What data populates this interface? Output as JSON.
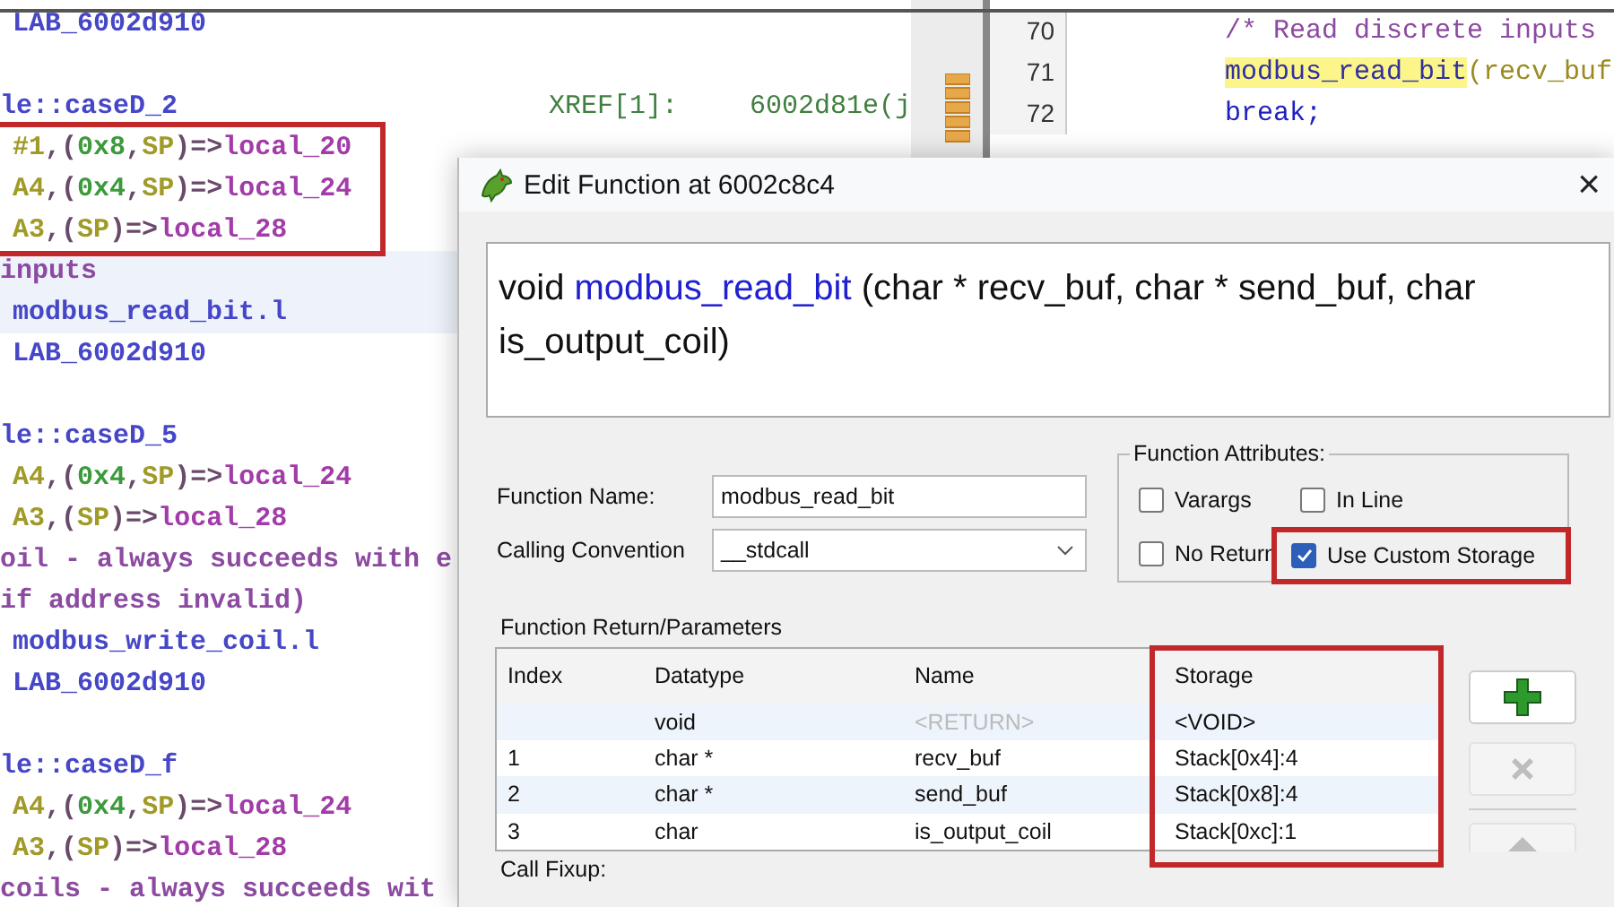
{
  "listing": {
    "lines": [
      {
        "kind": "code",
        "selected": false,
        "segments": [
          {
            "text": "LAB_6002d910",
            "kind": "label"
          }
        ]
      },
      {
        "kind": "blank"
      },
      {
        "kind": "header",
        "selected": false,
        "segments": [
          {
            "text": "le::caseD_2",
            "kind": "label"
          }
        ],
        "xref": {
          "label": "XREF[1]:",
          "address": "6002d81e(j"
        }
      },
      {
        "kind": "boxed_group",
        "lines": [
          {
            "kind": "code",
            "selected": false,
            "segments": [
              {
                "text": "#1",
                "kind": "reg"
              },
              {
                "text": ",(",
                "kind": "op"
              },
              {
                "text": "0x8",
                "kind": "num"
              },
              {
                "text": ",",
                "kind": "op"
              },
              {
                "text": "SP",
                "kind": "reg"
              },
              {
                "text": ")=>",
                "kind": "op"
              },
              {
                "text": "local_20",
                "kind": "local"
              }
            ]
          },
          {
            "kind": "code",
            "selected": false,
            "segments": [
              {
                "text": "A4",
                "kind": "reg"
              },
              {
                "text": ",(",
                "kind": "op"
              },
              {
                "text": "0x4",
                "kind": "num"
              },
              {
                "text": ",",
                "kind": "op"
              },
              {
                "text": "SP",
                "kind": "reg"
              },
              {
                "text": ")=>",
                "kind": "op"
              },
              {
                "text": "local_24",
                "kind": "local"
              }
            ]
          },
          {
            "kind": "code",
            "selected": false,
            "segments": [
              {
                "text": "A3",
                "kind": "reg"
              },
              {
                "text": ",(",
                "kind": "op"
              },
              {
                "text": "SP",
                "kind": "reg"
              },
              {
                "text": ")=>",
                "kind": "op"
              },
              {
                "text": "local_28",
                "kind": "local"
              }
            ]
          }
        ]
      },
      {
        "kind": "comment",
        "selected": true,
        "segments": [
          {
            "text": "inputs",
            "kind": "comment"
          }
        ]
      },
      {
        "kind": "code",
        "selected": true,
        "segments": [
          {
            "text": "modbus_read_bit.l",
            "kind": "label"
          }
        ]
      },
      {
        "kind": "code",
        "selected": false,
        "segments": [
          {
            "text": "LAB_6002d910",
            "kind": "label"
          }
        ]
      },
      {
        "kind": "blank"
      },
      {
        "kind": "header",
        "selected": false,
        "segments": [
          {
            "text": "le::caseD_5",
            "kind": "label"
          }
        ]
      },
      {
        "kind": "code",
        "selected": false,
        "segments": [
          {
            "text": "A4",
            "kind": "reg"
          },
          {
            "text": ",(",
            "kind": "op"
          },
          {
            "text": "0x4",
            "kind": "num"
          },
          {
            "text": ",",
            "kind": "op"
          },
          {
            "text": "SP",
            "kind": "reg"
          },
          {
            "text": ")=>",
            "kind": "op"
          },
          {
            "text": "local_24",
            "kind": "local"
          }
        ]
      },
      {
        "kind": "code",
        "selected": false,
        "segments": [
          {
            "text": "A3",
            "kind": "reg"
          },
          {
            "text": ",(",
            "kind": "op"
          },
          {
            "text": "SP",
            "kind": "reg"
          },
          {
            "text": ")=>",
            "kind": "op"
          },
          {
            "text": "local_28",
            "kind": "local"
          }
        ]
      },
      {
        "kind": "comment",
        "selected": false,
        "segments": [
          {
            "text": "oil - always succeeds with e",
            "kind": "comment"
          }
        ]
      },
      {
        "kind": "comment",
        "selected": false,
        "segments": [
          {
            "text": "if address invalid)",
            "kind": "comment"
          }
        ]
      },
      {
        "kind": "code",
        "selected": false,
        "segments": [
          {
            "text": "modbus_write_coil.l",
            "kind": "label"
          }
        ]
      },
      {
        "kind": "code",
        "selected": false,
        "segments": [
          {
            "text": "LAB_6002d910",
            "kind": "label"
          }
        ]
      },
      {
        "kind": "blank"
      },
      {
        "kind": "header",
        "selected": false,
        "segments": [
          {
            "text": "le::caseD_f",
            "kind": "label"
          }
        ]
      },
      {
        "kind": "code",
        "selected": false,
        "segments": [
          {
            "text": "A4",
            "kind": "reg"
          },
          {
            "text": ",(",
            "kind": "op"
          },
          {
            "text": "0x4",
            "kind": "num"
          },
          {
            "text": ",",
            "kind": "op"
          },
          {
            "text": "SP",
            "kind": "reg"
          },
          {
            "text": ")=>",
            "kind": "op"
          },
          {
            "text": "local_24",
            "kind": "local"
          }
        ]
      },
      {
        "kind": "code",
        "selected": false,
        "segments": [
          {
            "text": "A3",
            "kind": "reg"
          },
          {
            "text": ",(",
            "kind": "op"
          },
          {
            "text": "SP",
            "kind": "reg"
          },
          {
            "text": ")=>",
            "kind": "op"
          },
          {
            "text": "local_28",
            "kind": "local"
          }
        ]
      },
      {
        "kind": "comment",
        "selected": false,
        "segments": [
          {
            "text": "coils - always succeeds wit",
            "kind": "comment"
          }
        ]
      }
    ]
  },
  "decompiler": {
    "lines": [
      {
        "number": "70",
        "segments": [
          {
            "text": "/* Read discrete inputs",
            "kind": "comment",
            "highlighted": false
          }
        ]
      },
      {
        "number": "71",
        "segments": [
          {
            "text": "modbus_read_bit",
            "kind": "func",
            "highlighted": true
          },
          {
            "text": "(recv_buf",
            "kind": "var",
            "highlighted": false
          }
        ]
      },
      {
        "number": "72",
        "segments": [
          {
            "text": "break;",
            "kind": "keyword",
            "highlighted": false
          }
        ]
      }
    ]
  },
  "dialog": {
    "title": "Edit Function at 6002c8c4",
    "close": "×",
    "signature": [
      {
        "text": "void ",
        "kind": "type"
      },
      {
        "text": "modbus_read_bit",
        "kind": "name"
      },
      {
        "text": " (char * recv_buf, char * send_buf, char is_output_coil)",
        "kind": "type"
      }
    ],
    "function_name": {
      "label": "Function Name:",
      "value": "modbus_read_bit"
    },
    "calling_convention": {
      "label": "Calling Convention",
      "value": "__stdcall"
    },
    "attributes": {
      "title": "Function Attributes:",
      "items": [
        {
          "label": "Varargs",
          "checked": false,
          "highlighted": false
        },
        {
          "label": "In Line",
          "checked": false,
          "highlighted": false
        },
        {
          "label": "No Return",
          "checked": false,
          "highlighted": false
        },
        {
          "label": "Use Custom Storage",
          "checked": true,
          "highlighted": true
        }
      ]
    },
    "parameters": {
      "title": "Function Return/Parameters",
      "columns": [
        "Index",
        "Datatype",
        "Name",
        "Storage"
      ],
      "storage_highlighted": true,
      "rows": [
        {
          "index": "",
          "datatype": "void",
          "name": "<RETURN>",
          "name_disabled": true,
          "storage": "<VOID>"
        },
        {
          "index": "1",
          "datatype": "char *",
          "name": "recv_buf",
          "name_disabled": false,
          "storage": "Stack[0x4]:4"
        },
        {
          "index": "2",
          "datatype": "char *",
          "name": "send_buf",
          "name_disabled": false,
          "storage": "Stack[0x8]:4"
        },
        {
          "index": "3",
          "datatype": "char",
          "name": "is_output_coil",
          "name_disabled": false,
          "storage": "Stack[0xc]:1"
        }
      ]
    },
    "buttons": [
      {
        "kind": "add",
        "disabled": false
      },
      {
        "kind": "delete",
        "disabled": true
      },
      {
        "kind": "up",
        "disabled": true
      }
    ],
    "call_fixup": {
      "label": "Call Fixup:"
    }
  }
}
